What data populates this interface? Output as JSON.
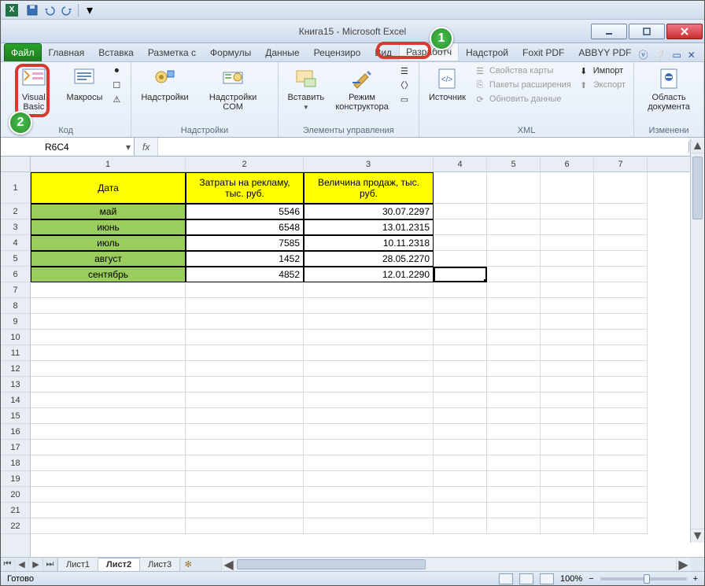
{
  "window": {
    "title": "Книга15 - Microsoft Excel"
  },
  "tabs": {
    "file": "Файл",
    "home": "Главная",
    "insert": "Вставка",
    "layout": "Разметка с",
    "formulas": "Формулы",
    "data": "Данные",
    "review": "Рецензиро",
    "view": "Вид",
    "developer": "Разработч",
    "addins": "Надстрой",
    "foxit": "Foxit PDF",
    "abbyy": "ABBYY PDF"
  },
  "ribbon": {
    "vb": "Visual Basic",
    "macros": "Макросы",
    "code_group": "Код",
    "addins": "Надстройки",
    "com_addins": "Надстройки COM",
    "addins_group": "Надстройки",
    "insert": "Вставить",
    "design_mode": "Режим конструктора",
    "controls_group": "Элементы управления",
    "source": "Источник",
    "map_props": "Свойства карты",
    "expansion": "Пакеты расширения",
    "refresh": "Обновить данные",
    "import": "Импорт",
    "export": "Экспорт",
    "xml_group": "XML",
    "doc_panel": "Область документа",
    "modify_group": "Изменени"
  },
  "namebox": "R6C4",
  "fx": "fx",
  "colheaders": [
    "1",
    "2",
    "3",
    "4",
    "5",
    "6",
    "7"
  ],
  "table": {
    "h1": "Дата",
    "h2": "Затраты на рекламу, тыс. руб.",
    "h3": "Величина продаж, тыс. руб.",
    "rows": [
      {
        "m": "май",
        "a": "5546",
        "b": "30.07.2297"
      },
      {
        "m": "июнь",
        "a": "6548",
        "b": "13.01.2315"
      },
      {
        "m": "июль",
        "a": "7585",
        "b": "10.11.2318"
      },
      {
        "m": "август",
        "a": "1452",
        "b": "28.05.2270"
      },
      {
        "m": "сентябрь",
        "a": "4852",
        "b": "12.01.2290"
      }
    ]
  },
  "sheets": {
    "s1": "Лист1",
    "s2": "Лист2",
    "s3": "Лист3"
  },
  "status": {
    "ready": "Готово",
    "zoom": "100%"
  },
  "badges": {
    "one": "1",
    "two": "2"
  }
}
